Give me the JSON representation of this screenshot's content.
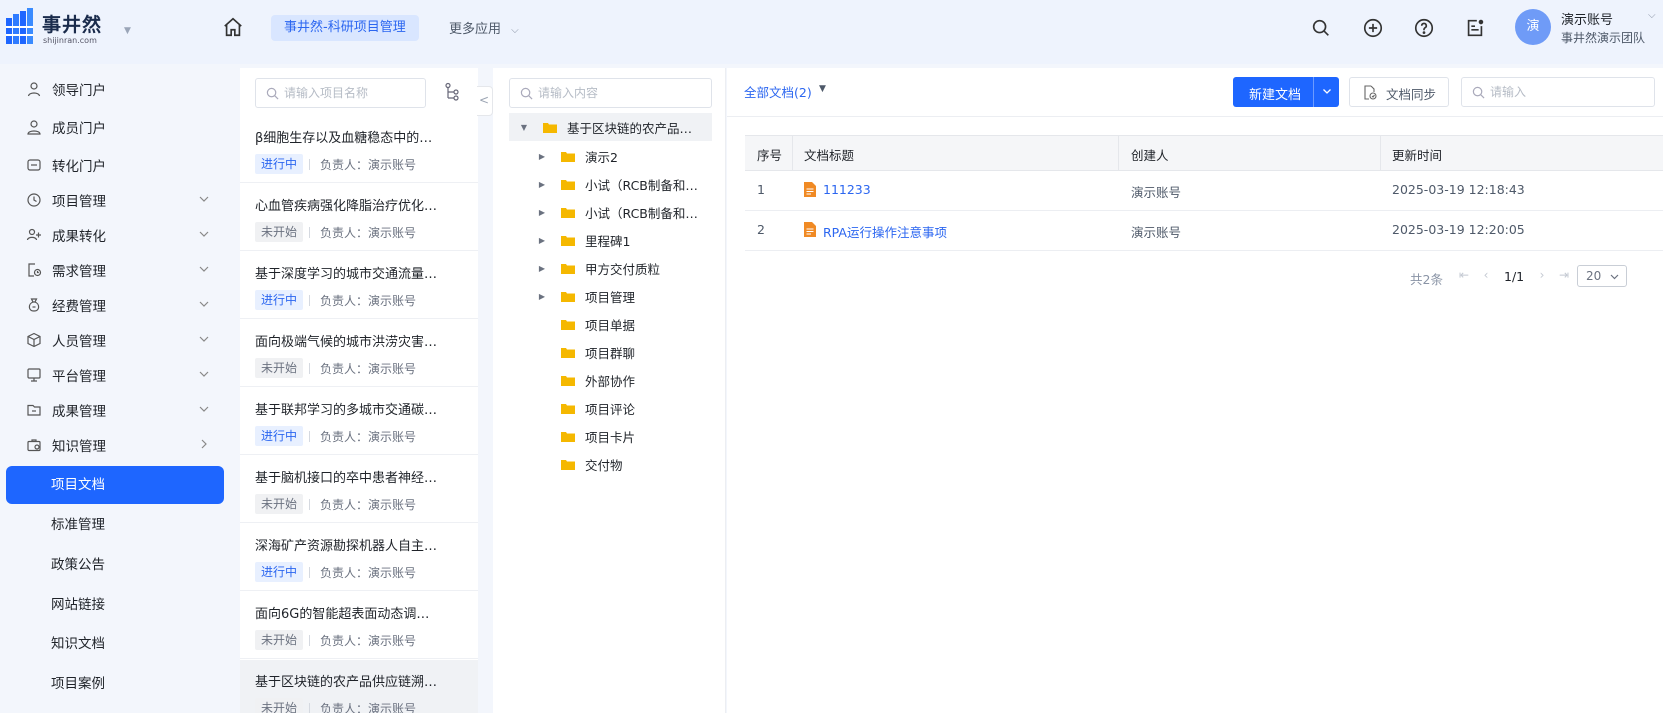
{
  "brand": {
    "name": "事井然",
    "domain": "shijinran.com",
    "accent": "#1e66ff"
  },
  "header": {
    "current_app": "事井然-科研项目管理",
    "more_apps": "更多应用",
    "user": {
      "avatar_text": "演",
      "name": "演示账号",
      "team": "事井然演示团队"
    }
  },
  "sidebar": {
    "items": [
      {
        "label": "领导门户",
        "icon": "person-icon",
        "expandable": false
      },
      {
        "label": "成员门户",
        "icon": "user-icon",
        "expandable": false
      },
      {
        "label": "转化门户",
        "icon": "transform-icon",
        "expandable": false
      },
      {
        "label": "项目管理",
        "icon": "clock-icon",
        "expandable": true
      },
      {
        "label": "成果转化",
        "icon": "group-icon",
        "expandable": true
      },
      {
        "label": "需求管理",
        "icon": "doc-clock-icon",
        "expandable": true
      },
      {
        "label": "经费管理",
        "icon": "money-bag-icon",
        "expandable": true
      },
      {
        "label": "人员管理",
        "icon": "cube-icon",
        "expandable": true
      },
      {
        "label": "平台管理",
        "icon": "monitor-icon",
        "expandable": true
      },
      {
        "label": "成果管理",
        "icon": "folder-icon",
        "expandable": true
      },
      {
        "label": "知识管理",
        "icon": "briefcase-icon",
        "expandable": true
      }
    ],
    "sub_items": [
      {
        "label": "项目文档",
        "active": true
      },
      {
        "label": "标准管理",
        "active": false
      },
      {
        "label": "政策公告",
        "active": false
      },
      {
        "label": "网站链接",
        "active": false
      },
      {
        "label": "知识文档",
        "active": false
      },
      {
        "label": "项目案例",
        "active": false
      }
    ]
  },
  "projects": {
    "search_placeholder": "请输入项目名称",
    "items": [
      {
        "title": "β细胞生存以及血糖稳态中的…",
        "status": "进行中",
        "status_type": "running",
        "owner": "负责人：演示账号"
      },
      {
        "title": "心血管疾病强化降脂治疗优化…",
        "status": "未开始",
        "status_type": "pending",
        "owner": "负责人：演示账号"
      },
      {
        "title": "基于深度学习的城市交通流量…",
        "status": "进行中",
        "status_type": "running",
        "owner": "负责人：演示账号"
      },
      {
        "title": "面向极端气候的城市洪涝灾害…",
        "status": "未开始",
        "status_type": "pending",
        "owner": "负责人：演示账号"
      },
      {
        "title": "基于联邦学习的多城市交通碳…",
        "status": "进行中",
        "status_type": "running",
        "owner": "负责人：演示账号"
      },
      {
        "title": "基于脑机接口的卒中患者神经…",
        "status": "未开始",
        "status_type": "pending",
        "owner": "负责人：演示账号"
      },
      {
        "title": "深海矿产资源勘探机器人自主…",
        "status": "进行中",
        "status_type": "running",
        "owner": "负责人：演示账号"
      },
      {
        "title": "面向6G的智能超表面动态调…",
        "status": "未开始",
        "status_type": "pending",
        "owner": "负责人：演示账号"
      },
      {
        "title": "基于区块链的农产品供应链溯…",
        "status": "未开始",
        "status_type": "pending",
        "owner": "负责人：演示账号",
        "selected": true
      }
    ]
  },
  "tree": {
    "search_placeholder": "请输入内容",
    "root": "基于区块链的农产品…",
    "children": [
      {
        "label": "演示2",
        "has_children": true
      },
      {
        "label": "小试（RCB制备和…",
        "has_children": true
      },
      {
        "label": "小试（RCB制备和…",
        "has_children": true
      },
      {
        "label": "里程碑1",
        "has_children": true
      },
      {
        "label": "甲方交付质粒",
        "has_children": true
      },
      {
        "label": "项目管理",
        "has_children": true
      },
      {
        "label": "项目单据",
        "has_children": false
      },
      {
        "label": "项目群聊",
        "has_children": false
      },
      {
        "label": "外部协作",
        "has_children": false
      },
      {
        "label": "项目评论",
        "has_children": false
      },
      {
        "label": "项目卡片",
        "has_children": false
      },
      {
        "label": "交付物",
        "has_children": false
      }
    ]
  },
  "documents": {
    "filter_label": "全部文档(2)",
    "new_button": "新建文档",
    "sync_button": "文档同步",
    "search_placeholder": "请输入",
    "columns": [
      "序号",
      "文档标题",
      "创建人",
      "更新时间"
    ],
    "rows": [
      {
        "index": "1",
        "title": "111233",
        "creator": "演示账号",
        "updated": "2025-03-19 12:18:43"
      },
      {
        "index": "2",
        "title": "RPA运行操作注意事项",
        "creator": "演示账号",
        "updated": "2025-03-19 12:20:05"
      }
    ],
    "pagination": {
      "total": "共2条",
      "current": "1/1",
      "page_size": "20"
    }
  }
}
